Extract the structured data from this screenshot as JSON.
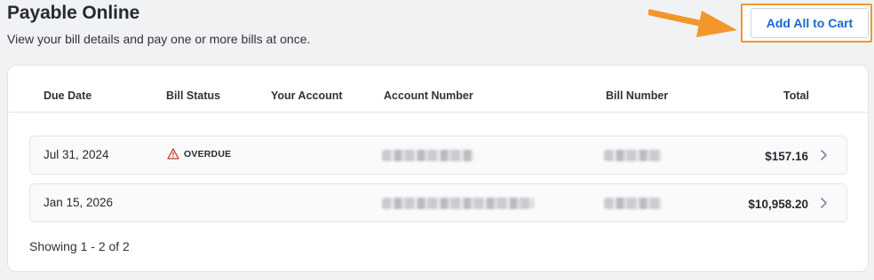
{
  "header": {
    "title": "Payable Online",
    "subtitle": "View your bill details and pay one or more bills at once."
  },
  "actions": {
    "add_all_label": "Add All to Cart"
  },
  "colors": {
    "accent": "#1868d6",
    "highlight": "#f3962c",
    "overdue": "#c0392b"
  },
  "table": {
    "columns": [
      "Due Date",
      "Bill Status",
      "Your Account",
      "Account Number",
      "Bill Number",
      "Total"
    ],
    "rows": [
      {
        "due_date": "Jul 31, 2024",
        "status": "OVERDUE",
        "status_icon": "warning-triangle-icon",
        "your_account": "",
        "total": "$157.16"
      },
      {
        "due_date": "Jan 15, 2026",
        "status": "",
        "your_account": "",
        "total": "$10,958.20"
      }
    ],
    "footer": "Showing 1 - 2 of 2"
  }
}
